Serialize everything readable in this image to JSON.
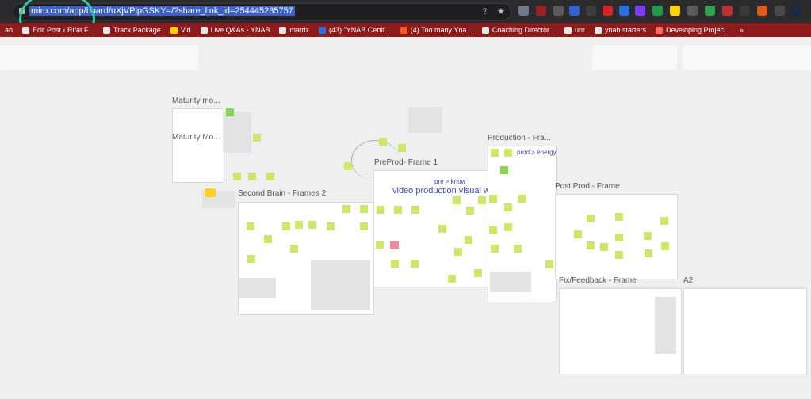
{
  "browser": {
    "url": "miro.com/app/board/uXjVPlpGSKY=/?share_link_id=254445235757"
  },
  "bookmarks": [
    {
      "label": "an"
    },
    {
      "label": "Edit Post ‹ Rifat F..."
    },
    {
      "label": "Track Package"
    },
    {
      "label": "Vid"
    },
    {
      "label": "Live Q&As - YNAB"
    },
    {
      "label": "matrix"
    },
    {
      "label": "(43) \"YNAB Certif..."
    },
    {
      "label": "(4) Too many Yna..."
    },
    {
      "label": "Coaching Director..."
    },
    {
      "label": "unr"
    },
    {
      "label": "ynab starters"
    },
    {
      "label": "Developing Projec..."
    }
  ],
  "board": {
    "frames": [
      {
        "title": "Maturity mo..."
      },
      {
        "title": "Maturity Mo..."
      },
      {
        "title": "Second Brain - Frames 2"
      },
      {
        "title": "PreProd- Frame 1"
      },
      {
        "title": "Production - Fra..."
      },
      {
        "title": "Post Prod - Frame"
      },
      {
        "title": "Fix/Feedback - Frame"
      },
      {
        "title": "A2"
      }
    ],
    "texts": {
      "pre_know": "pre > know",
      "walkthrough": "video production visual walk through",
      "prod_energy": "prod > energy"
    }
  }
}
